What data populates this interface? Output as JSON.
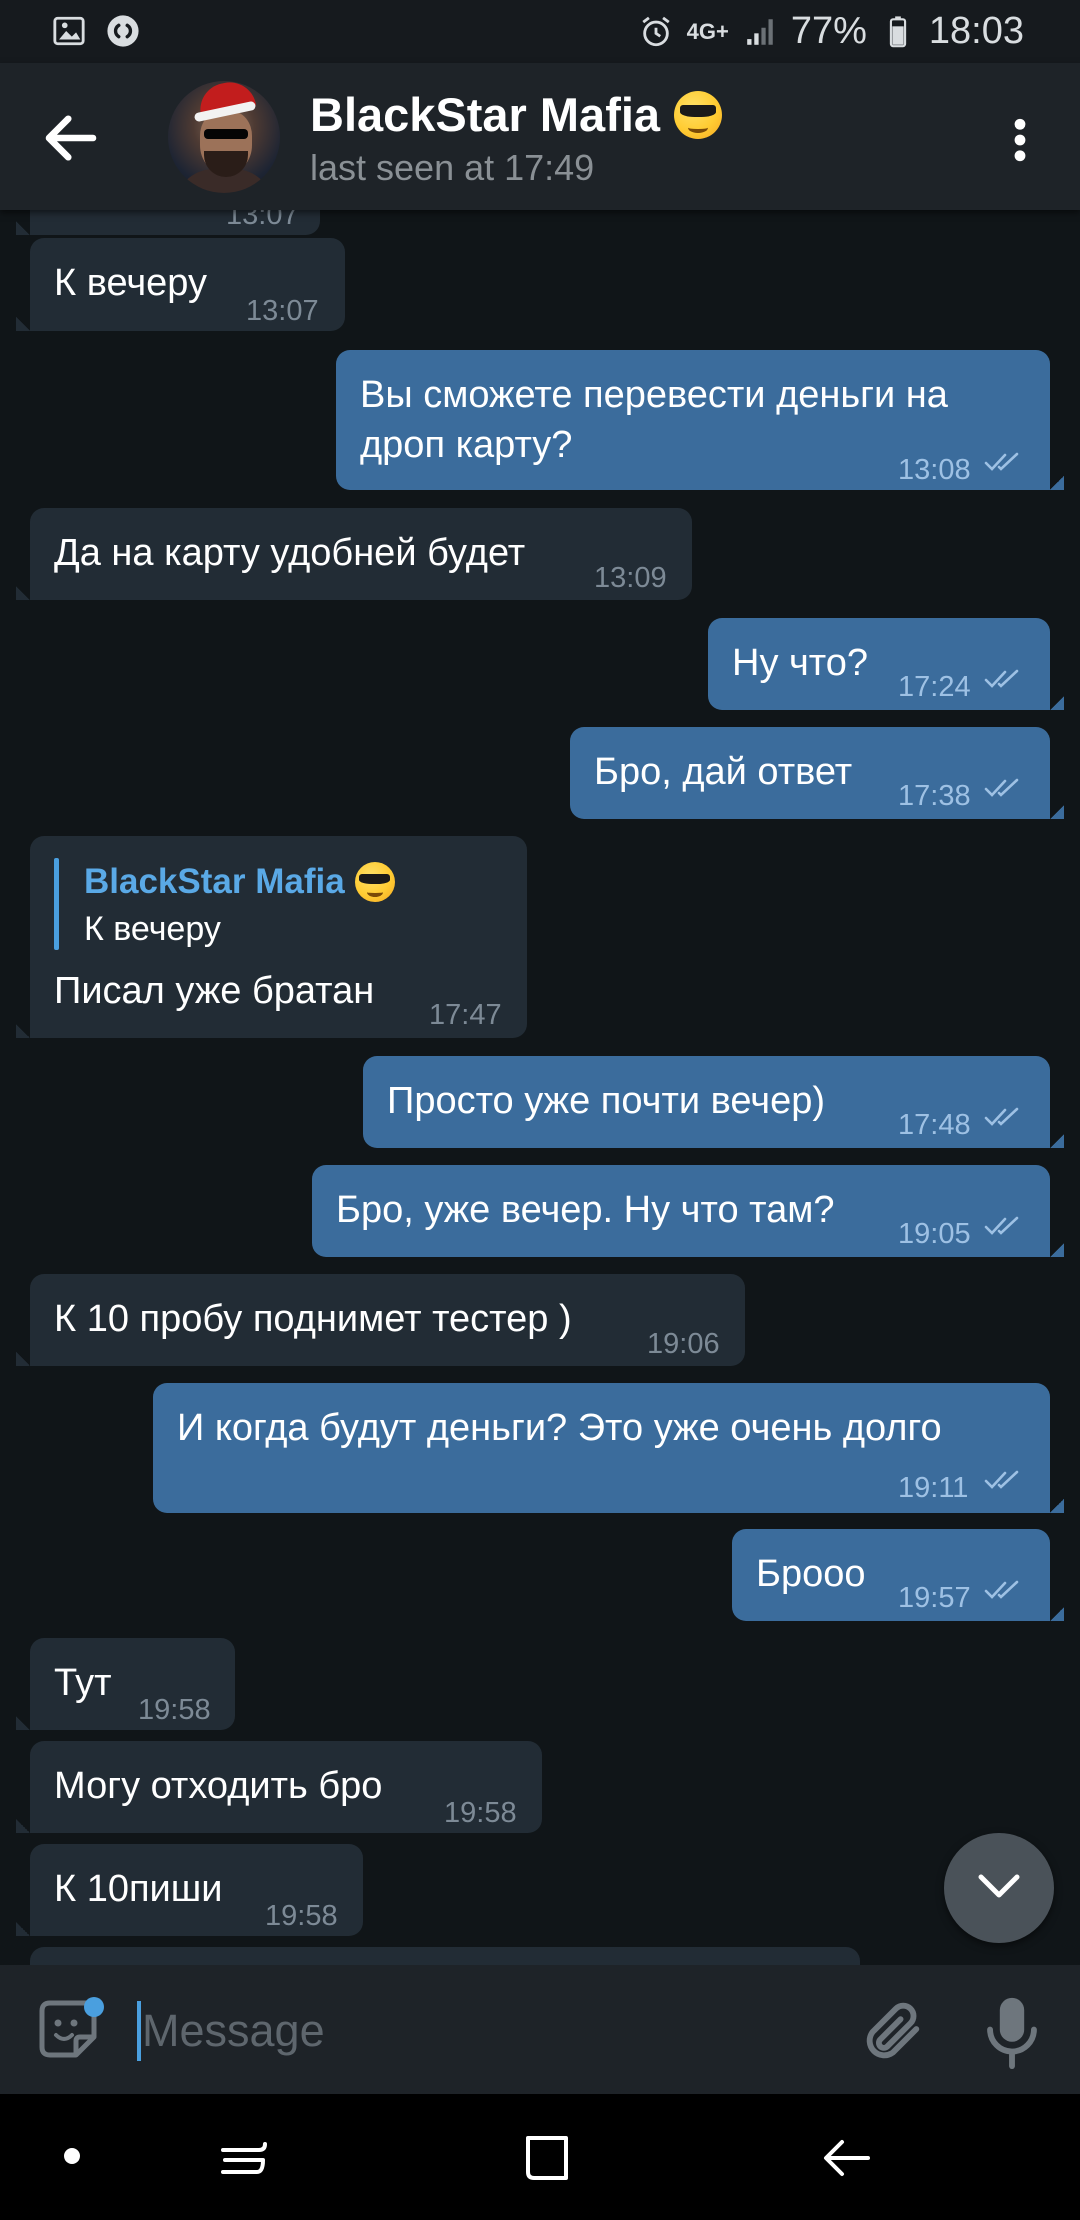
{
  "status_bar": {
    "network": "4G+",
    "battery": "77%",
    "time": "18:03",
    "icons": [
      "gallery-icon",
      "shazam-icon",
      "alarm-icon",
      "network-icon",
      "signal-icon",
      "battery-icon"
    ]
  },
  "header": {
    "name": "BlackStar Mafia",
    "status": "last seen at 17:49",
    "icons": [
      "back-arrow-icon",
      "avatar",
      "sunglasses-emoji",
      "more-vert-icon"
    ]
  },
  "messages": [
    {
      "dir": "in",
      "text": "",
      "time": "13:07"
    },
    {
      "dir": "in",
      "text": "К вечеру",
      "time": "13:07"
    },
    {
      "dir": "out",
      "lines": [
        "Вы сможете перевести деньги на",
        "дроп карту?"
      ],
      "time": "13:08",
      "read": true
    },
    {
      "dir": "in",
      "text": "Да на карту удобней будет",
      "time": "13:09"
    },
    {
      "dir": "out",
      "text": "Ну что?",
      "time": "17:24",
      "read": true
    },
    {
      "dir": "out",
      "text": "Бро, дай ответ",
      "time": "17:38",
      "read": true
    },
    {
      "dir": "in",
      "reply": {
        "name": "BlackStar Mafia",
        "text": "К вечеру"
      },
      "text": "Писал уже братан",
      "time": "17:47"
    },
    {
      "dir": "out",
      "text": "Просто уже почти вечер)",
      "time": "17:48",
      "read": true
    },
    {
      "dir": "out",
      "text": "Бро, уже вечер. Ну что там?",
      "time": "19:05",
      "read": true
    },
    {
      "dir": "in",
      "text": "К 10 пробу поднимет тестер )",
      "time": "19:06"
    },
    {
      "dir": "out",
      "text": "И когда будут деньги? Это уже очень долго",
      "time": "19:11",
      "read": true
    },
    {
      "dir": "out",
      "text": "Брооо",
      "time": "19:57",
      "read": true
    },
    {
      "dir": "in",
      "text": "Тут",
      "time": "19:58"
    },
    {
      "dir": "in",
      "text": "Могу отходить бро",
      "time": "19:58"
    },
    {
      "dir": "in",
      "text": "К 10пиши",
      "time": "19:58"
    }
  ],
  "input": {
    "placeholder": "Message"
  },
  "colors": {
    "background": "#101518",
    "header": "#1e2328",
    "incoming_bubble": "#222c35",
    "outgoing_bubble": "#3b6c9c",
    "accent": "#4a9fdf"
  }
}
